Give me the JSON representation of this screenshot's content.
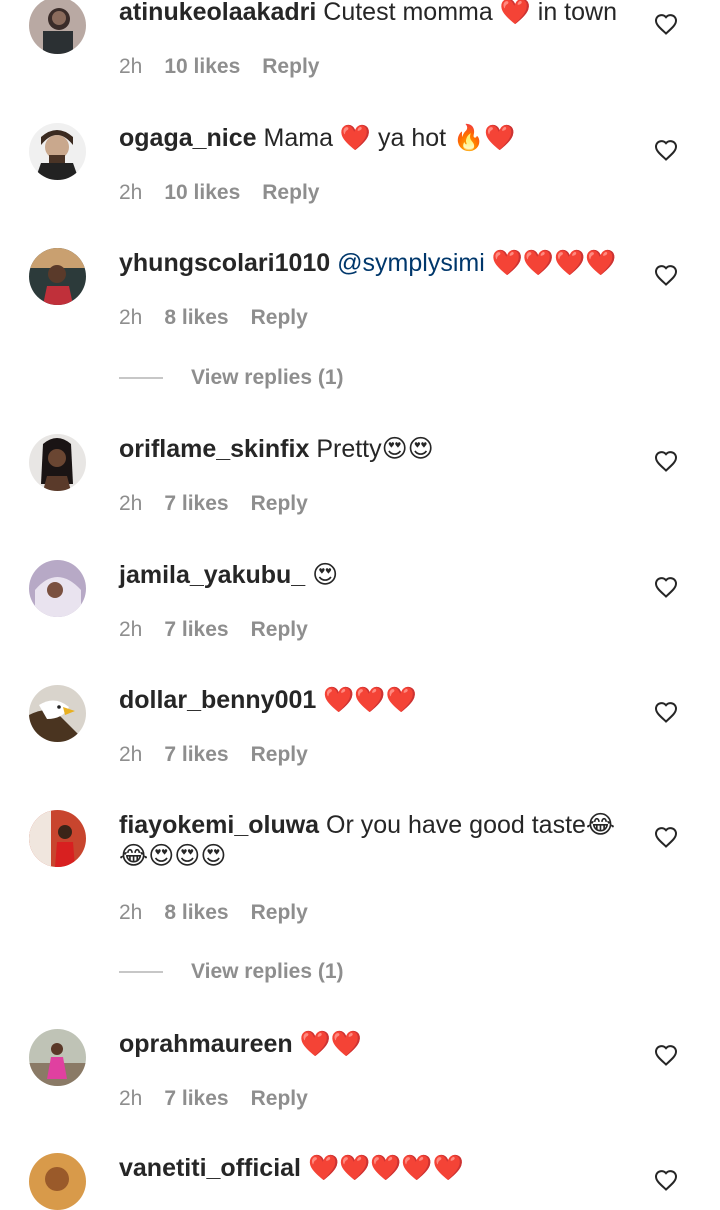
{
  "comments": [
    {
      "username": "atinukeolaakadri",
      "text": "Cutest momma ❤️ in town",
      "time": "2h",
      "likes": "10 likes",
      "reply": "Reply",
      "avatar": "avatar-1"
    },
    {
      "username": "ogaga_nice",
      "text": "Mama ❤️ ya hot 🔥❤️",
      "time": "2h",
      "likes": "10 likes",
      "reply": "Reply",
      "avatar": "avatar-2"
    },
    {
      "username": "yhungscolari1010",
      "mention": "@symplysimi",
      "text": "❤️❤️❤️❤️",
      "time": "2h",
      "likes": "8 likes",
      "reply": "Reply",
      "view_replies": "View replies (1)",
      "avatar": "avatar-3"
    },
    {
      "username": "oriflame_skinfix",
      "text": "Pretty😍😍",
      "time": "2h",
      "likes": "7 likes",
      "reply": "Reply",
      "avatar": "avatar-4"
    },
    {
      "username": "jamila_yakubu_",
      "text": "😍",
      "time": "2h",
      "likes": "7 likes",
      "reply": "Reply",
      "avatar": "avatar-5"
    },
    {
      "username": "dollar_benny001",
      "text": "❤️❤️❤️",
      "time": "2h",
      "likes": "7 likes",
      "reply": "Reply",
      "avatar": "avatar-6"
    },
    {
      "username": "fiayokemi_oluwa",
      "text": "Or you have good taste😂",
      "text2": "😂😍😍😍",
      "time": "2h",
      "likes": "8 likes",
      "reply": "Reply",
      "view_replies": "View replies (1)",
      "avatar": "avatar-7"
    },
    {
      "username": "oprahmaureen",
      "text": "❤️❤️",
      "time": "2h",
      "likes": "7 likes",
      "reply": "Reply",
      "avatar": "avatar-8"
    },
    {
      "username": "vanetiti_official",
      "text": "❤️❤️❤️❤️❤️",
      "avatar": "avatar-9"
    }
  ],
  "icons": {
    "like": "heart-outline-icon"
  }
}
